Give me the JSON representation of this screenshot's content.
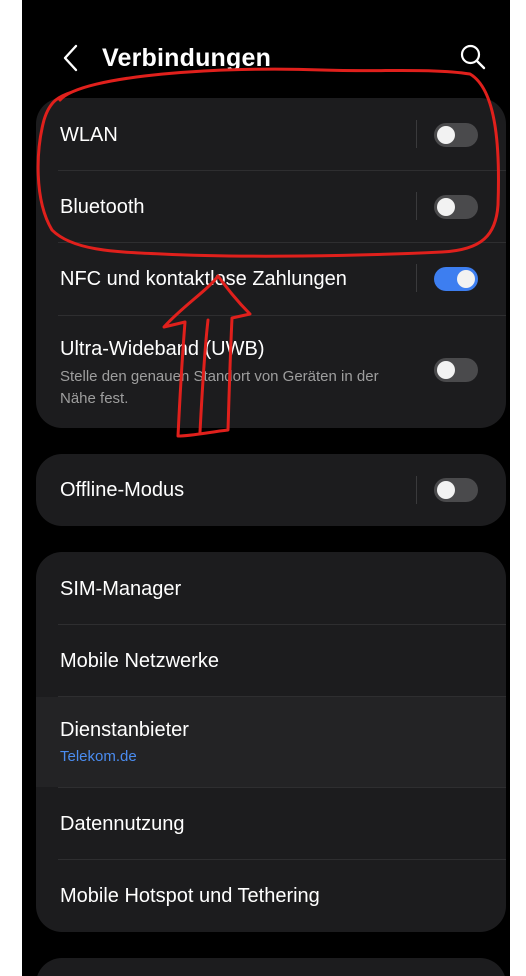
{
  "header": {
    "title": "Verbindungen",
    "back_icon": "chevron-left-icon",
    "search_icon": "search-icon"
  },
  "group1": {
    "items": [
      {
        "label": "WLAN",
        "toggle": "off"
      },
      {
        "label": "Bluetooth",
        "toggle": "off"
      },
      {
        "label": "NFC und kontaktlose Zahlungen",
        "toggle": "on"
      },
      {
        "label": "Ultra-Wideband (UWB)",
        "subtitle": "Stelle den genauen Standort von Geräten in der Nähe fest.",
        "toggle": "off"
      }
    ]
  },
  "group2": {
    "items": [
      {
        "label": "Offline-Modus",
        "toggle": "off"
      }
    ]
  },
  "group3": {
    "items": [
      {
        "label": "SIM-Manager"
      },
      {
        "label": "Mobile Netzwerke"
      },
      {
        "label": "Dienstanbieter",
        "subtitle": "Telekom.de"
      },
      {
        "label": "Datennutzung"
      },
      {
        "label": "Mobile Hotspot und Tethering"
      }
    ]
  },
  "colors": {
    "background": "#000000",
    "card": "#1c1c1e",
    "accent": "#3d7ef0",
    "link": "#4a8cf0",
    "annotation": "#e0201c"
  }
}
